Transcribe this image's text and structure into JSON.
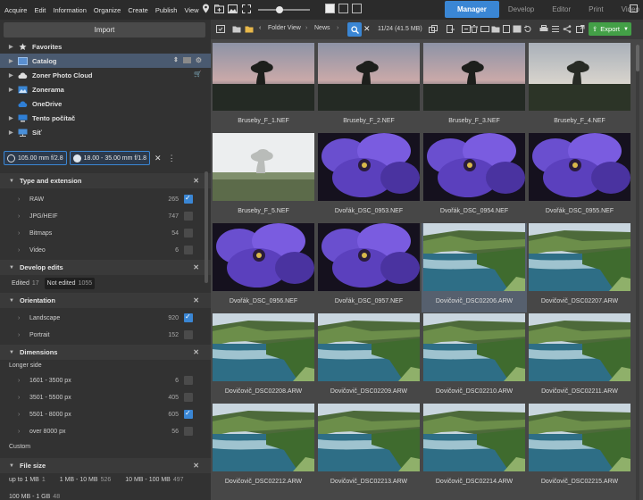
{
  "menu": [
    "Acquire",
    "Edit",
    "Information",
    "Organize",
    "Create",
    "Publish",
    "View"
  ],
  "modes": [
    {
      "label": "Manager",
      "active": true
    },
    {
      "label": "Develop",
      "active": false
    },
    {
      "label": "Editor",
      "active": false
    },
    {
      "label": "Print",
      "active": false
    },
    {
      "label": "Video",
      "active": false
    }
  ],
  "left": {
    "import_label": "Import",
    "nav": [
      {
        "label": "Favorites",
        "icon": "star-icon",
        "selected": false
      },
      {
        "label": "Catalog",
        "icon": "catalog-icon",
        "selected": true
      },
      {
        "label": "Zoner Photo Cloud",
        "icon": "cloud-icon",
        "selected": false
      },
      {
        "label": "Zonerama",
        "icon": "zonerama-icon",
        "selected": false
      },
      {
        "label": "OneDrive",
        "icon": "onedrive-icon",
        "selected": false
      },
      {
        "label": "Tento počítač",
        "icon": "computer-icon",
        "selected": false
      },
      {
        "label": "Síť",
        "icon": "network-icon",
        "selected": false
      }
    ],
    "chips": [
      "105.00 mm f/2.8",
      "18.00 - 35.00 mm f/1.8"
    ],
    "sections": {
      "type": {
        "title": "Type and extension",
        "rows": [
          {
            "label": "RAW",
            "count": "265",
            "checked": true
          },
          {
            "label": "JPG/HEIF",
            "count": "747",
            "checked": false
          },
          {
            "label": "Bitmaps",
            "count": "54",
            "checked": false
          },
          {
            "label": "Video",
            "count": "6",
            "checked": false
          }
        ]
      },
      "develop": {
        "title": "Develop edits",
        "edited_label": "Edited",
        "edited_count": "17",
        "not_edited_label": "Not edited",
        "not_edited_count": "1055"
      },
      "orientation": {
        "title": "Orientation",
        "rows": [
          {
            "label": "Landscape",
            "count": "920",
            "checked": true
          },
          {
            "label": "Portrait",
            "count": "152",
            "checked": false
          }
        ]
      },
      "dimensions": {
        "title": "Dimensions",
        "sub_label": "Longer side",
        "rows": [
          {
            "label": "1601 - 3500 px",
            "count": "6",
            "checked": false
          },
          {
            "label": "3501 - 5500 px",
            "count": "405",
            "checked": false
          },
          {
            "label": "5501 - 8000 px",
            "count": "605",
            "checked": true
          },
          {
            "label": "over 8000 px",
            "count": "56",
            "checked": false
          }
        ],
        "custom_label": "Custom"
      },
      "filesize": {
        "title": "File size",
        "row1": [
          {
            "label": "up to 1 MB",
            "count": "1"
          },
          {
            "label": "1 MB - 10 MB",
            "count": "526"
          },
          {
            "label": "10 MB - 100 MB",
            "count": "497"
          }
        ],
        "row2": [
          {
            "label": "100 MB - 1 GB",
            "count": "48"
          }
        ]
      }
    }
  },
  "toolbar": {
    "breadcrumb": [
      "Folder View",
      "News"
    ],
    "count": "11/24 (41.5 MB)",
    "export_label": "Export"
  },
  "colors": {
    "accent": "#3a86d4",
    "export": "#43a047",
    "selected_tile": "#56606e"
  },
  "photos": [
    {
      "name": "Bruseby_F_1.NEF",
      "kind": "tree-dusk"
    },
    {
      "name": "Bruseby_F_2.NEF",
      "kind": "tree-dusk"
    },
    {
      "name": "Bruseby_F_3.NEF",
      "kind": "tree-dusk"
    },
    {
      "name": "Bruseby_F_4.NEF",
      "kind": "tree-day"
    },
    {
      "name": "Bruseby_F_5.NEF",
      "kind": "tree-fog"
    },
    {
      "name": "Dvořák_DSC_0953.NEF",
      "kind": "flower"
    },
    {
      "name": "Dvořák_DSC_0954.NEF",
      "kind": "flower"
    },
    {
      "name": "Dvořák_DSC_0955.NEF",
      "kind": "flower"
    },
    {
      "name": "Dvořák_DSC_0956.NEF",
      "kind": "flower"
    },
    {
      "name": "Dvořák_DSC_0957.NEF",
      "kind": "flower"
    },
    {
      "name": "Dovičovič_DSC02206.ARW",
      "kind": "coast",
      "selected": true
    },
    {
      "name": "Dovičovič_DSC02207.ARW",
      "kind": "coast"
    },
    {
      "name": "Dovičovič_DSC02208.ARW",
      "kind": "coast"
    },
    {
      "name": "Dovičovič_DSC02209.ARW",
      "kind": "coast"
    },
    {
      "name": "Dovičovič_DSC02210.ARW",
      "kind": "coast"
    },
    {
      "name": "Dovičovič_DSC02211.ARW",
      "kind": "coast"
    },
    {
      "name": "Dovičovič_DSC02212.ARW",
      "kind": "coast"
    },
    {
      "name": "Dovičovič_DSC02213.ARW",
      "kind": "coast"
    },
    {
      "name": "Dovičovič_DSC02214.ARW",
      "kind": "coast"
    },
    {
      "name": "Dovičovič_DSC02215.ARW",
      "kind": "coast"
    }
  ]
}
